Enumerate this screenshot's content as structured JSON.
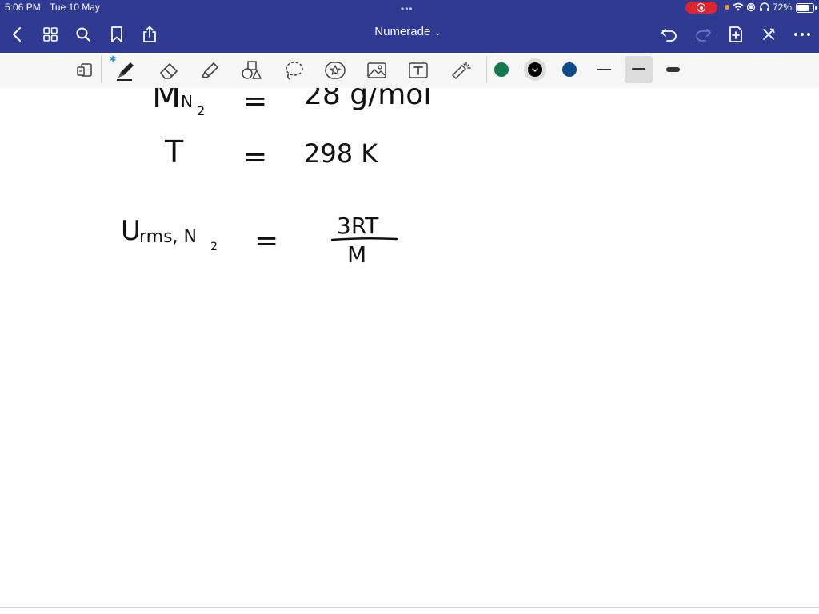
{
  "status_bar": {
    "time": "5:06 PM",
    "date": "Tue 10 May",
    "battery_percent": "72%",
    "battery_level": 0.72
  },
  "app": {
    "title": "Numerade"
  },
  "nav_icons": [
    "back-icon",
    "thumbnails-grid-icon",
    "search-icon",
    "bookmark-icon",
    "share-icon"
  ],
  "right_nav_icons": [
    "undo-icon",
    "redo-icon",
    "add-page-icon",
    "close-icon",
    "more-icon"
  ],
  "toolbar": {
    "tools": [
      "page-scan-icon",
      "pen-icon",
      "eraser-icon",
      "highlighter-icon",
      "shapes-icon",
      "lasso-icon",
      "sticker-icon",
      "image-icon",
      "text-icon",
      "laser-pointer-icon"
    ],
    "selected_tool": "pen-icon",
    "colors": [
      "#127a4e",
      "#000000",
      "#0c4a8a"
    ],
    "selected_color": "#000000",
    "stroke_widths": [
      "thin",
      "medium",
      "thick"
    ],
    "selected_width": "medium"
  },
  "notes": {
    "line1": {
      "lhs": "M",
      "sub": "N",
      "subsub": "2",
      "eq": "=",
      "rhs": "28 g/mol"
    },
    "line2": {
      "lhs": "T",
      "eq": "=",
      "rhs": "298 K"
    },
    "line3": {
      "lhs": "U",
      "sub": "rms, N",
      "subsub": "2",
      "eq": "=",
      "num": "3RT",
      "den": "M"
    }
  },
  "ink_color": "#111111"
}
